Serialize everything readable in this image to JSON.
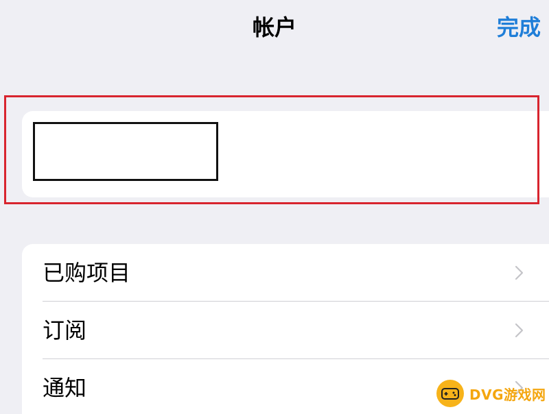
{
  "nav": {
    "title": "帐户",
    "done_label": "完成"
  },
  "account_card": {
    "highlight_color": "#d8242e",
    "redacted": true
  },
  "menu": {
    "items": [
      {
        "label": "已购项目",
        "icon": "chevron-right-icon"
      },
      {
        "label": "订阅",
        "icon": "chevron-right-icon"
      },
      {
        "label": "通知",
        "icon": "chevron-right-icon"
      }
    ]
  },
  "watermark": {
    "text": "DVG游戏网",
    "icon": "gamepad-icon"
  },
  "colors": {
    "background": "#efeff4",
    "accent": "#1f7ed8",
    "card": "#ffffff"
  }
}
